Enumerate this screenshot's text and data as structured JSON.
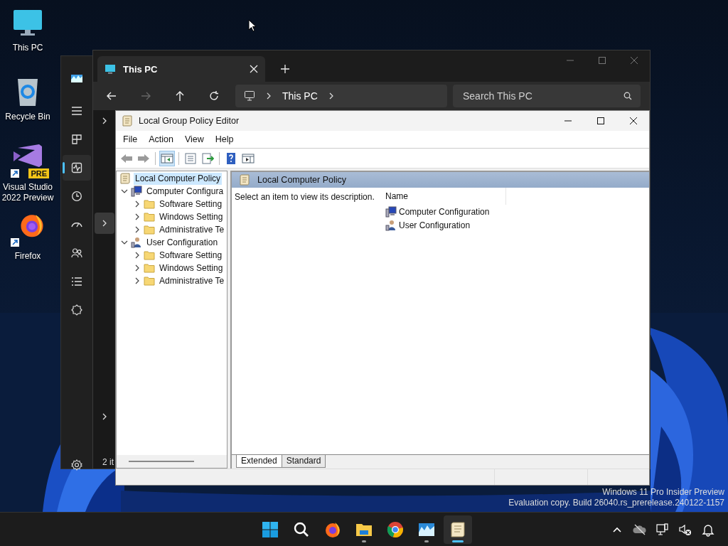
{
  "desktop_icons": [
    {
      "kind": "pc",
      "label": "This PC"
    },
    {
      "kind": "bin",
      "label": "Recycle Bin"
    },
    {
      "kind": "vs",
      "label": "Visual Studio 2022 Preview",
      "badge": "PRE",
      "shortcut": true
    },
    {
      "kind": "firefox",
      "label": "Firefox",
      "shortcut": true
    }
  ],
  "task_manager": {
    "nav": [
      {
        "kind": "logo",
        "selected": false
      },
      {
        "kind": "menu",
        "selected": false
      },
      {
        "kind": "processes",
        "selected": false
      },
      {
        "kind": "performance",
        "selected": true
      },
      {
        "kind": "history",
        "selected": false
      },
      {
        "kind": "startup",
        "selected": false
      },
      {
        "kind": "users",
        "selected": false
      },
      {
        "kind": "details",
        "selected": false
      },
      {
        "kind": "services",
        "selected": false
      },
      {
        "kind": "settings",
        "selected": false
      }
    ]
  },
  "explorer": {
    "tab": "This PC",
    "nav_buttons": [
      {
        "kind": "back",
        "disabled": false
      },
      {
        "kind": "forward",
        "disabled": true
      },
      {
        "kind": "up",
        "disabled": false
      },
      {
        "kind": "refresh",
        "disabled": false
      }
    ],
    "breadcrumb": [
      "This PC"
    ],
    "search": {
      "placeholder": "Search This PC"
    },
    "nav_rows": [
      {
        "highlighted": false
      },
      {
        "highlighted": true
      },
      {
        "highlighted": false
      }
    ],
    "status": "2 it"
  },
  "gpe": {
    "title": "Local Group Policy Editor",
    "menu": [
      "File",
      "Action",
      "View",
      "Help"
    ],
    "toolbar": [
      {
        "kind": "back",
        "on": false
      },
      {
        "kind": "forward",
        "on": false
      },
      {
        "kind": "sep"
      },
      {
        "kind": "tree",
        "on": true
      },
      {
        "kind": "sep"
      },
      {
        "kind": "properties",
        "on": false
      },
      {
        "kind": "export",
        "on": false
      },
      {
        "kind": "sep"
      },
      {
        "kind": "help",
        "on": false
      },
      {
        "kind": "pane",
        "on": false
      }
    ],
    "tree": [
      {
        "label": "Local Computer Policy",
        "kind": "policy",
        "selected": true,
        "children": [
          {
            "label": "Computer Configura",
            "kind": "computer",
            "selected": false,
            "expanded": true,
            "children": [
              {
                "label": "Software Setting",
                "kind": "folder",
                "selected": false,
                "expanded": false
              },
              {
                "label": "Windows Setting",
                "kind": "folder",
                "selected": false,
                "expanded": false
              },
              {
                "label": "Administrative Te",
                "kind": "folder",
                "selected": false,
                "expanded": false
              }
            ]
          },
          {
            "label": "User Configuration",
            "kind": "user",
            "selected": false,
            "expanded": true,
            "children": [
              {
                "label": "Software Setting",
                "kind": "folder",
                "selected": false,
                "expanded": false
              },
              {
                "label": "Windows Setting",
                "kind": "folder",
                "selected": false,
                "expanded": false
              },
              {
                "label": "Administrative Te",
                "kind": "folder",
                "selected": false,
                "expanded": false
              }
            ]
          }
        ]
      }
    ],
    "header": "Local Computer Policy",
    "description": "Select an item to view its description.",
    "column": "Name",
    "items": [
      {
        "label": "Computer Configuration",
        "kind": "computer"
      },
      {
        "label": "User Configuration",
        "kind": "user"
      }
    ],
    "tabs": [
      {
        "label": "Extended",
        "selected": true
      },
      {
        "label": "Standard",
        "selected": false
      }
    ]
  },
  "watermark": [
    "Windows 11 Pro Insider Preview",
    "Evaluation copy. Build 26040.rs_prerelease.240122-1157"
  ],
  "taskbar": {
    "apps": [
      {
        "kind": "start",
        "running": false,
        "selected": false
      },
      {
        "kind": "search",
        "running": false,
        "selected": false
      },
      {
        "kind": "firefox",
        "running": false,
        "selected": false
      },
      {
        "kind": "files",
        "running": true,
        "selected": false
      },
      {
        "kind": "chrome",
        "running": false,
        "selected": false
      },
      {
        "kind": "taskmgr",
        "running": true,
        "selected": false
      },
      {
        "kind": "gpe",
        "running": true,
        "selected": true
      }
    ],
    "tray": [
      {
        "kind": "chevron"
      },
      {
        "kind": "cloud"
      },
      {
        "kind": "network"
      },
      {
        "kind": "volume-muted"
      },
      {
        "kind": "bell"
      }
    ]
  }
}
